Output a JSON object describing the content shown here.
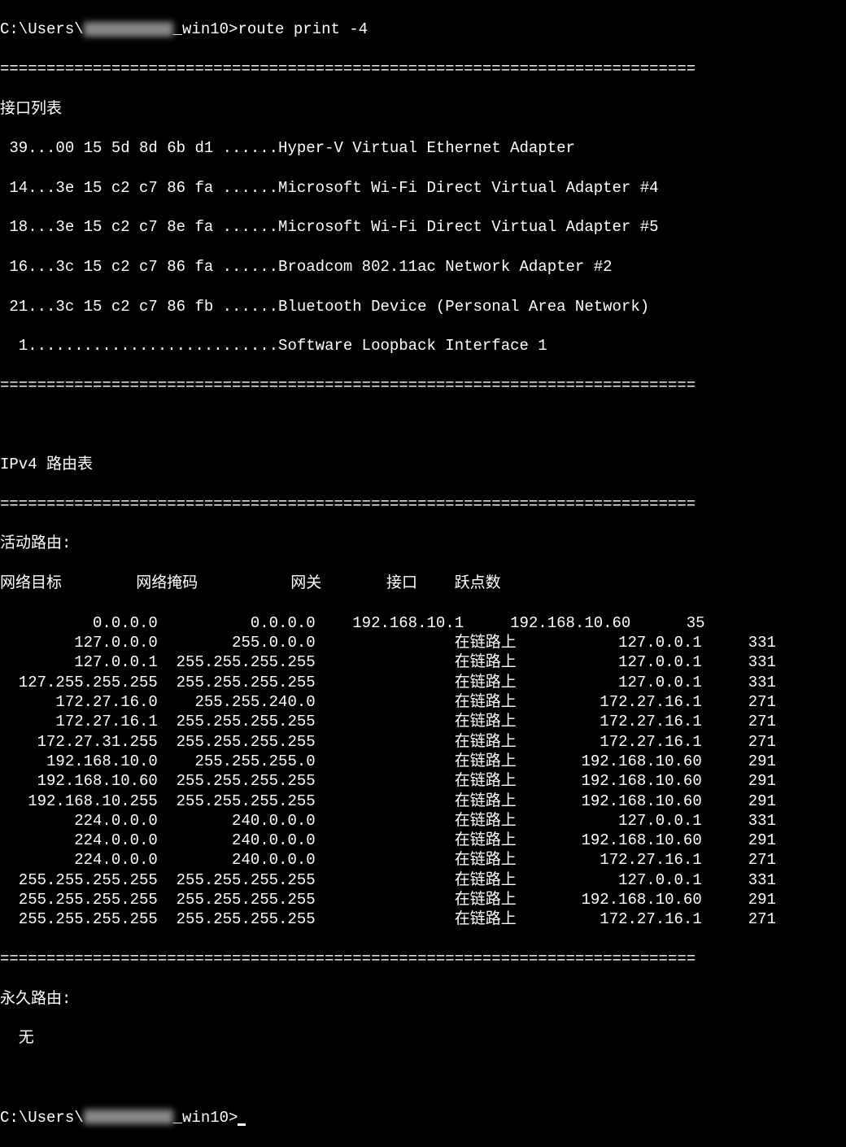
{
  "prompt_prefix": "C:\\Users\\",
  "prompt_user_obscured": "         ",
  "prompt_suffix": "_win10>",
  "command": "route print -4",
  "divider": "===========================================================================",
  "interface_list_header": "接口列表",
  "interfaces": [
    " 39...00 15 5d 8d 6b d1 ......Hyper-V Virtual Ethernet Adapter",
    " 14...3e 15 c2 c7 86 fa ......Microsoft Wi-Fi Direct Virtual Adapter #4",
    " 18...3e 15 c2 c7 8e fa ......Microsoft Wi-Fi Direct Virtual Adapter #5",
    " 16...3c 15 c2 c7 86 fa ......Broadcom 802.11ac Network Adapter #2",
    " 21...3c 15 c2 c7 86 fb ......Bluetooth Device (Personal Area Network)",
    "  1...........................Software Loopback Interface 1"
  ],
  "ipv4_route_table_header": "IPv4 路由表",
  "active_routes_header": "活动路由:",
  "columns": {
    "dest": "网络目标",
    "mask": "网络掩码",
    "gateway": "网关",
    "interface": "接口",
    "metric": "跃点数"
  },
  "routes": [
    {
      "dest": "0.0.0.0",
      "mask": "0.0.0.0",
      "gateway": "192.168.10.1",
      "interface": "192.168.10.60",
      "metric": "35"
    },
    {
      "dest": "127.0.0.0",
      "mask": "255.0.0.0",
      "gateway": "在链路上",
      "interface": "127.0.0.1",
      "metric": "331"
    },
    {
      "dest": "127.0.0.1",
      "mask": "255.255.255.255",
      "gateway": "在链路上",
      "interface": "127.0.0.1",
      "metric": "331"
    },
    {
      "dest": "127.255.255.255",
      "mask": "255.255.255.255",
      "gateway": "在链路上",
      "interface": "127.0.0.1",
      "metric": "331"
    },
    {
      "dest": "172.27.16.0",
      "mask": "255.255.240.0",
      "gateway": "在链路上",
      "interface": "172.27.16.1",
      "metric": "271"
    },
    {
      "dest": "172.27.16.1",
      "mask": "255.255.255.255",
      "gateway": "在链路上",
      "interface": "172.27.16.1",
      "metric": "271"
    },
    {
      "dest": "172.27.31.255",
      "mask": "255.255.255.255",
      "gateway": "在链路上",
      "interface": "172.27.16.1",
      "metric": "271"
    },
    {
      "dest": "192.168.10.0",
      "mask": "255.255.255.0",
      "gateway": "在链路上",
      "interface": "192.168.10.60",
      "metric": "291"
    },
    {
      "dest": "192.168.10.60",
      "mask": "255.255.255.255",
      "gateway": "在链路上",
      "interface": "192.168.10.60",
      "metric": "291"
    },
    {
      "dest": "192.168.10.255",
      "mask": "255.255.255.255",
      "gateway": "在链路上",
      "interface": "192.168.10.60",
      "metric": "291"
    },
    {
      "dest": "224.0.0.0",
      "mask": "240.0.0.0",
      "gateway": "在链路上",
      "interface": "127.0.0.1",
      "metric": "331"
    },
    {
      "dest": "224.0.0.0",
      "mask": "240.0.0.0",
      "gateway": "在链路上",
      "interface": "192.168.10.60",
      "metric": "291"
    },
    {
      "dest": "224.0.0.0",
      "mask": "240.0.0.0",
      "gateway": "在链路上",
      "interface": "172.27.16.1",
      "metric": "271"
    },
    {
      "dest": "255.255.255.255",
      "mask": "255.255.255.255",
      "gateway": "在链路上",
      "interface": "127.0.0.1",
      "metric": "331"
    },
    {
      "dest": "255.255.255.255",
      "mask": "255.255.255.255",
      "gateway": "在链路上",
      "interface": "192.168.10.60",
      "metric": "291"
    },
    {
      "dest": "255.255.255.255",
      "mask": "255.255.255.255",
      "gateway": "在链路上",
      "interface": "172.27.16.1",
      "metric": "271"
    }
  ],
  "persistent_routes_header": "永久路由:",
  "persistent_routes_none": "  无"
}
